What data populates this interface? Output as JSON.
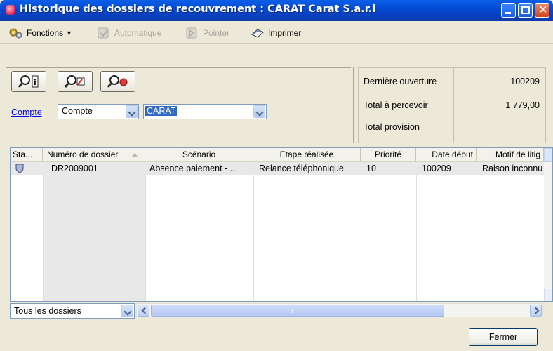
{
  "window": {
    "title": "Historique des dossiers de recouvrement :  CARAT Carat S.a.r.l"
  },
  "toolbar": {
    "fonctions": "Fonctions",
    "automatique": "Automatique",
    "pointer": "Pointer",
    "imprimer": "Imprimer"
  },
  "filters": {
    "compte_link": "Compte",
    "compte_type": "Compte",
    "compte_value": "CARAT"
  },
  "stats": {
    "derniere_ouverture_label": "Dernière ouverture",
    "derniere_ouverture_value": "100209",
    "total_percevoir_label": "Total à percevoir",
    "total_percevoir_value": "1 779,00",
    "total_provision_label": "Total provision",
    "total_provision_value": ""
  },
  "grid": {
    "columns": [
      "Sta...",
      "Numéro de dossier",
      "Scénario",
      "Etape réalisée",
      "Priorité",
      "Date début",
      "Motif de litig"
    ],
    "rows": [
      {
        "numero": "DR2009001",
        "scenario": "Absence paiement - ...",
        "etape": "Relance téléphonique",
        "priorite": "10",
        "date_debut": "100209",
        "motif": "Raison inconnu"
      }
    ]
  },
  "bottom": {
    "filter_value": "Tous les dossiers"
  },
  "buttons": {
    "fermer": "Fermer"
  }
}
